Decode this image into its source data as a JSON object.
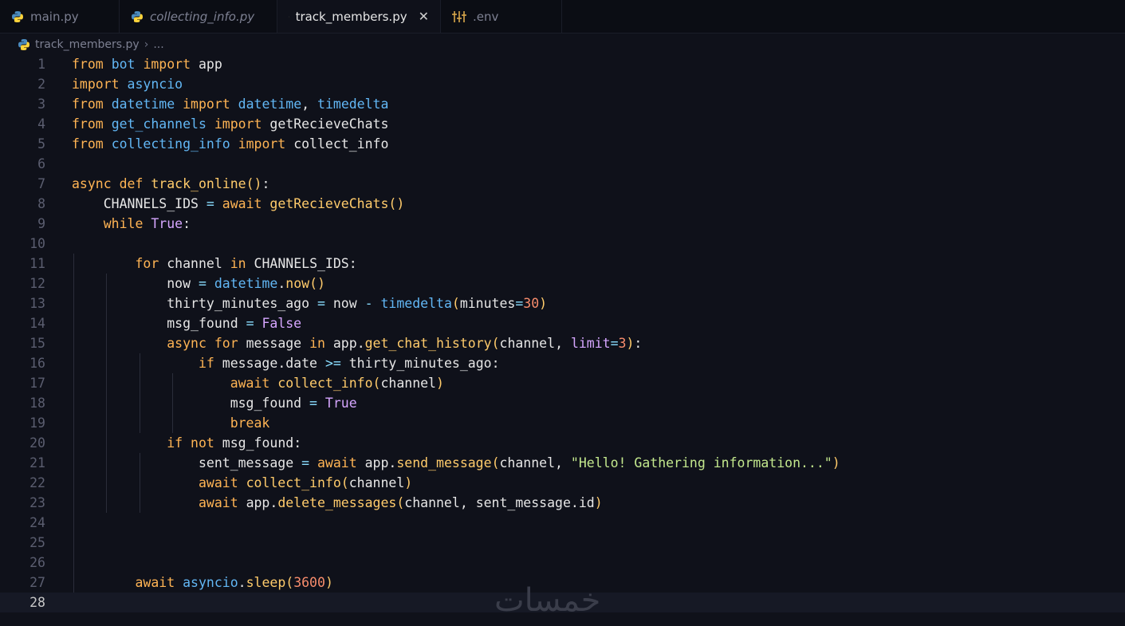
{
  "tabs": [
    {
      "name": "main.py",
      "icon": "python-icon",
      "italic": false,
      "active": false
    },
    {
      "name": "collecting_info.py",
      "icon": "python-icon",
      "italic": true,
      "active": false
    },
    {
      "name": "track_members.py",
      "icon": "python-icon",
      "italic": false,
      "active": true,
      "close": "✕"
    },
    {
      "name": ".env",
      "icon": "env-settings-icon",
      "italic": false,
      "active": false
    }
  ],
  "breadcrumb": {
    "file": "track_members.py",
    "separator": "›",
    "more": "..."
  },
  "current_line": 28,
  "watermark": "خمسات",
  "colors": {
    "background": "#0f111a",
    "keyword": "#ffb454",
    "module": "#62b7f5",
    "string": "#c3e88d",
    "boolean": "#d6a6ff"
  },
  "code_lines": [
    "from bot import app",
    "import asyncio",
    "from datetime import datetime, timedelta",
    "from get_channels import getRecieveChats",
    "from collecting_info import collect_info",
    "",
    "async def track_online():",
    "    CHANNELS_IDS = await getRecieveChats()",
    "    while True:",
    "",
    "        for channel in CHANNELS_IDS:",
    "            now = datetime.now()",
    "            thirty_minutes_ago = now - timedelta(minutes=30)",
    "            msg_found = False",
    "            async for message in app.get_chat_history(channel, limit=3):",
    "                if message.date >= thirty_minutes_ago:",
    "                    await collect_info(channel)",
    "                    msg_found = True",
    "                    break",
    "            if not msg_found:",
    "                sent_message = await app.send_message(channel, \"Hello! Gathering information...\")",
    "                await collect_info(channel)",
    "                await app.delete_messages(channel, sent_message.id)",
    "",
    "",
    "",
    "        await asyncio.sleep(3600)",
    ""
  ]
}
